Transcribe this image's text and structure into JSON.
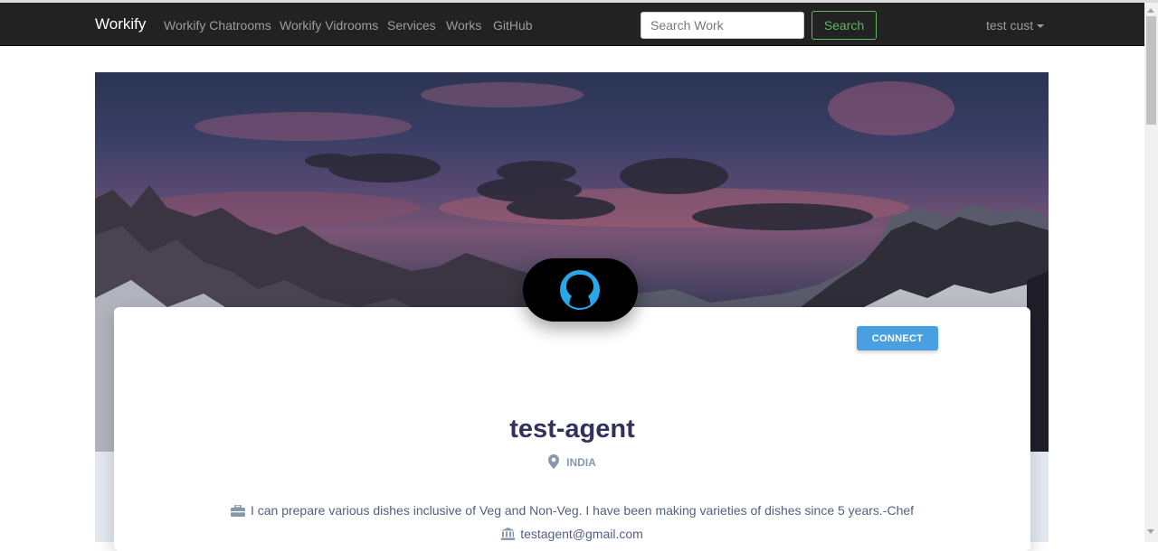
{
  "navbar": {
    "brand": "Workify",
    "links": [
      "Workify Chatrooms",
      "Workify Vidrooms",
      "Services",
      "Works",
      "GitHub"
    ],
    "search": {
      "placeholder": "Search Work",
      "button_label": "Search"
    },
    "user_menu": "test cust"
  },
  "profile": {
    "connect_label": "CONNECT",
    "name": "test-agent",
    "location": "INDIA",
    "bio": "I can prepare various dishes inclusive of Veg and Non-Veg. I have been making varieties of dishes since 5 years.-Chef",
    "email": "testagent@gmail.com"
  },
  "colors": {
    "navbar_bg": "#222222",
    "search_button": "#5cb85c",
    "connect_button": "#4a9fe0",
    "avatar_icon": "#2aa7e8",
    "name_text": "#32325d"
  },
  "icons": {
    "location": "map-pin-icon",
    "bio": "briefcase-icon",
    "email": "bank-icon",
    "avatar": "user-silhouette-icon"
  }
}
